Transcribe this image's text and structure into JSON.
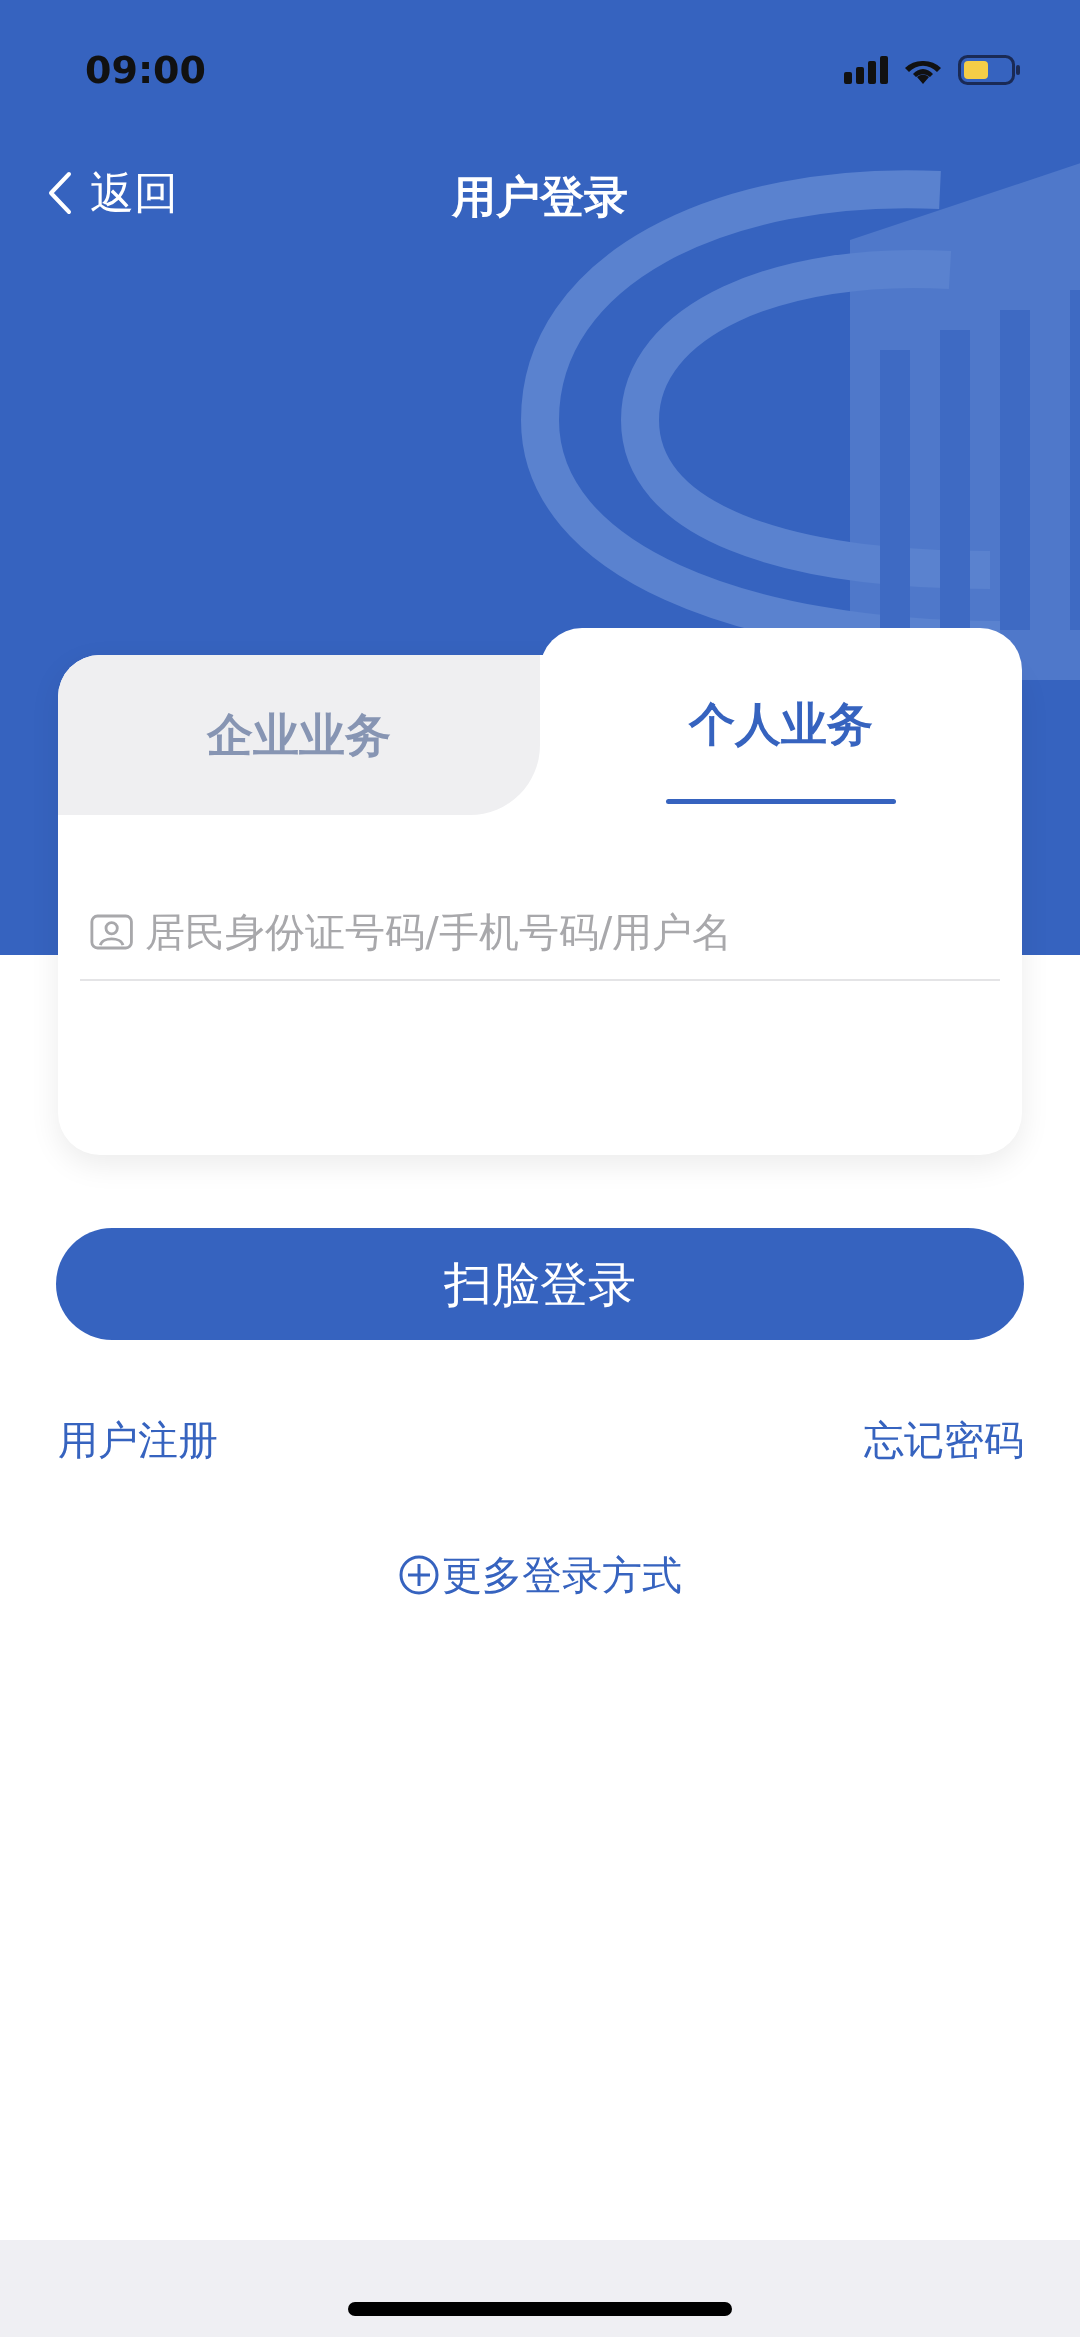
{
  "status_bar": {
    "time": "09:00"
  },
  "nav": {
    "back": "返回",
    "title": "用户登录"
  },
  "tabs": [
    {
      "label": "企业业务",
      "selected": false
    },
    {
      "label": "个人业务",
      "selected": true
    }
  ],
  "login_field": {
    "placeholder": "居民身份证号码/手机号码/用户名"
  },
  "primary_button": "扫脸登录",
  "links": [
    "用户注册",
    "忘记密码"
  ],
  "more_options": "更多登录方式"
}
